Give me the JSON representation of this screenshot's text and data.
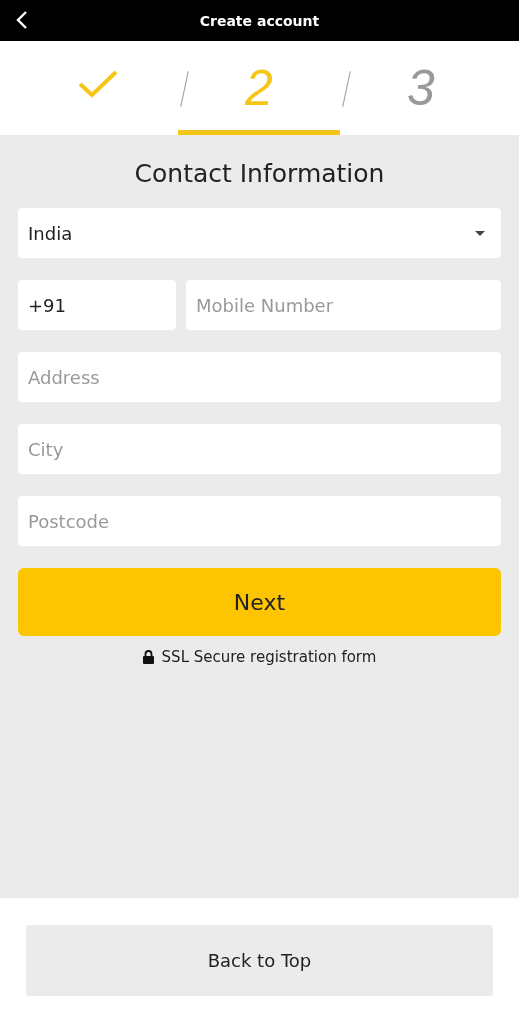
{
  "header": {
    "title": "Create account"
  },
  "steps": [
    {
      "kind": "done",
      "selected": false
    },
    {
      "kind": "number",
      "label": "2",
      "selected": true
    },
    {
      "kind": "number",
      "label": "3",
      "selected": false
    }
  ],
  "form": {
    "title": "Contact Information",
    "country": {
      "value": "India"
    },
    "phone": {
      "code": "+91",
      "placeholder": "Mobile Number"
    },
    "fields": [
      {
        "placeholder": "Address"
      },
      {
        "placeholder": "City"
      },
      {
        "placeholder": "Postcode"
      }
    ],
    "submit": "Next",
    "note": "SSL Secure registration form"
  },
  "footer": {
    "button": "Back to Top"
  }
}
